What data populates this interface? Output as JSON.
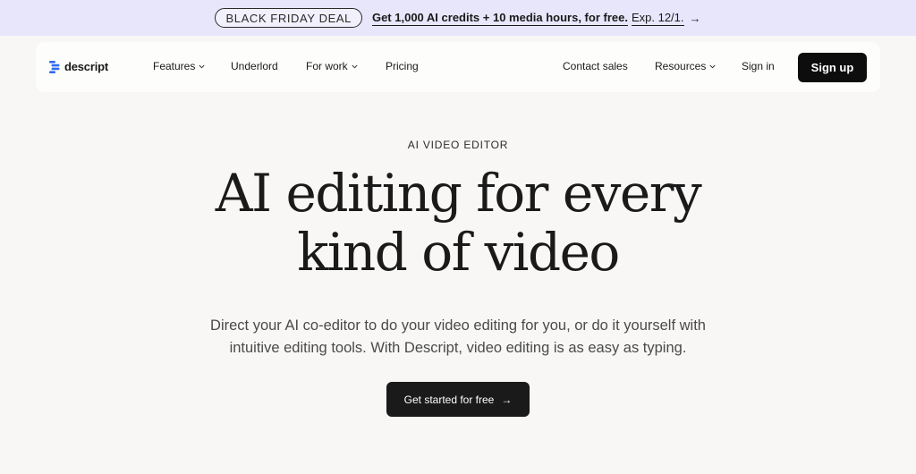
{
  "promo": {
    "badge": "BLACK FRIDAY DEAL",
    "text": "Get 1,000 AI credits + 10 media hours, for free.",
    "expiry": "Exp. 12/1.",
    "arrow": "→"
  },
  "nav": {
    "logo_text": "descript",
    "items": [
      {
        "label": "Features"
      },
      {
        "label": "Underlord"
      },
      {
        "label": "For work"
      },
      {
        "label": "Pricing"
      }
    ],
    "right_items": [
      {
        "label": "Contact sales"
      },
      {
        "label": "Resources"
      },
      {
        "label": "Sign in"
      }
    ],
    "signup_label": "Sign up"
  },
  "hero": {
    "eyebrow": "AI VIDEO EDITOR",
    "headline_line1": "AI editing for every",
    "headline_line2": "kind of video",
    "sub_line1": "Direct your AI co-editor to do your video editing for you, or do it yourself with",
    "sub_line2": "intuitive editing tools. With Descript, video editing is as easy as typing.",
    "cta_label": "Get started for free",
    "cta_arrow": "→"
  },
  "colors": {
    "page_bg": "#f8f7f5",
    "promo_bg": "#e8e6fb",
    "logo_blue": "#2f6bf0",
    "button_dark": "#0d0d0d"
  },
  "icons": {
    "logo": "descript-logo-icon",
    "chevron": "chevron-down-icon",
    "arrow": "arrow-right-icon"
  }
}
